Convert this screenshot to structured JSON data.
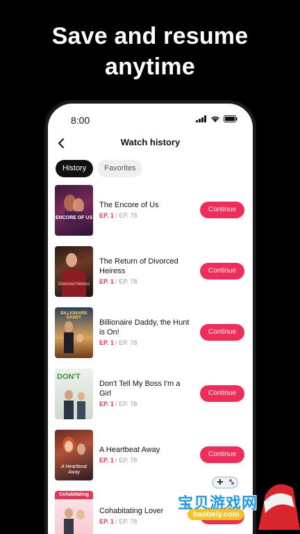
{
  "headline": {
    "line1": "Save and resume",
    "line2": "anytime"
  },
  "status_bar": {
    "time": "8:00"
  },
  "nav": {
    "title": "Watch history"
  },
  "tabs": [
    {
      "label": "History",
      "active": true
    },
    {
      "label": "Favorites",
      "active": false
    }
  ],
  "items": [
    {
      "title": "The Encore of Us",
      "ep_current": "EP. 1",
      "ep_total": "/ EP. 78",
      "action": "Continue",
      "poster_text": "ENCORE OF US"
    },
    {
      "title": "The Return of Divorced Heiress",
      "ep_current": "EP. 1",
      "ep_total": "/ EP. 78",
      "action": "Continue",
      "poster_text": "Divorced Heiress"
    },
    {
      "title": "Billionaire Daddy, the Hunt is On!",
      "ep_current": "EP. 1",
      "ep_total": "/ EP. 78",
      "action": "Continue",
      "poster_text": "BILLIONAIRE DADDY"
    },
    {
      "title": "Don't Tell My Boss I'm a Girl",
      "ep_current": "EP. 1",
      "ep_total": "/ EP. 78",
      "action": "Continue",
      "poster_text": "DON'T"
    },
    {
      "title": "A Heartbeat Away",
      "ep_current": "EP. 1",
      "ep_total": "/ EP. 78",
      "action": "Continue",
      "poster_text": "A Heartbeat Away"
    },
    {
      "title": "Cohabitating Lover",
      "ep_current": "EP. 1",
      "ep_total": "/ EP. 78",
      "action": "Continue",
      "poster_text": "Cohabitating"
    }
  ],
  "watermark": {
    "text": "宝贝游戏网",
    "url": "baobeiy.com"
  },
  "colors": {
    "accent": "#f02c58",
    "episode_current": "#e8325a",
    "background": "#000000"
  }
}
